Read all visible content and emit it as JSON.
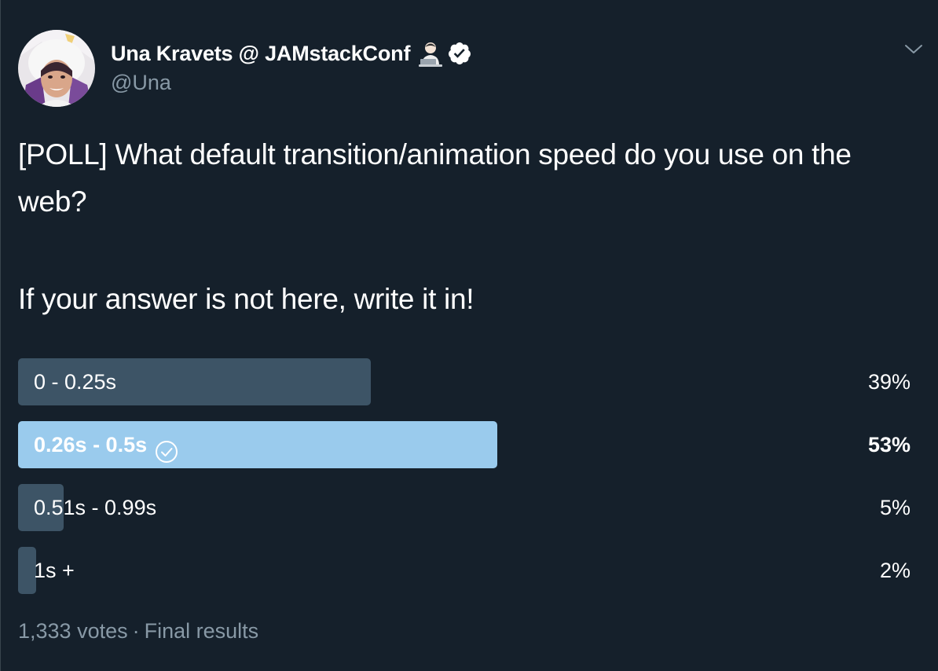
{
  "author": {
    "display_name": "Una Kravets @ JAMstackConf",
    "handle": "@Una",
    "emoji_icon": "technologist-emoji-icon",
    "verified_icon": "verified-badge-icon"
  },
  "tweet": {
    "line1": "[POLL] What default transition/animation speed do you use on the web?",
    "line2": "If your answer is not here, write it in!"
  },
  "poll": {
    "options": [
      {
        "label": "0 - 0.25s",
        "percent": "39%",
        "value": 39,
        "winner": false
      },
      {
        "label": "0.26s - 0.5s",
        "percent": "53%",
        "value": 53,
        "winner": true
      },
      {
        "label": "0.51s - 0.99s",
        "percent": "5%",
        "value": 5,
        "winner": false
      },
      {
        "label": "1s +",
        "percent": "2%",
        "value": 2,
        "winner": false
      }
    ],
    "votes": "1,333 votes",
    "separator": "·",
    "status": "Final results"
  },
  "colors": {
    "background": "#15202b",
    "bar": "#3d5466",
    "winner_bar": "#9acbed",
    "secondary_text": "#8899a6"
  }
}
